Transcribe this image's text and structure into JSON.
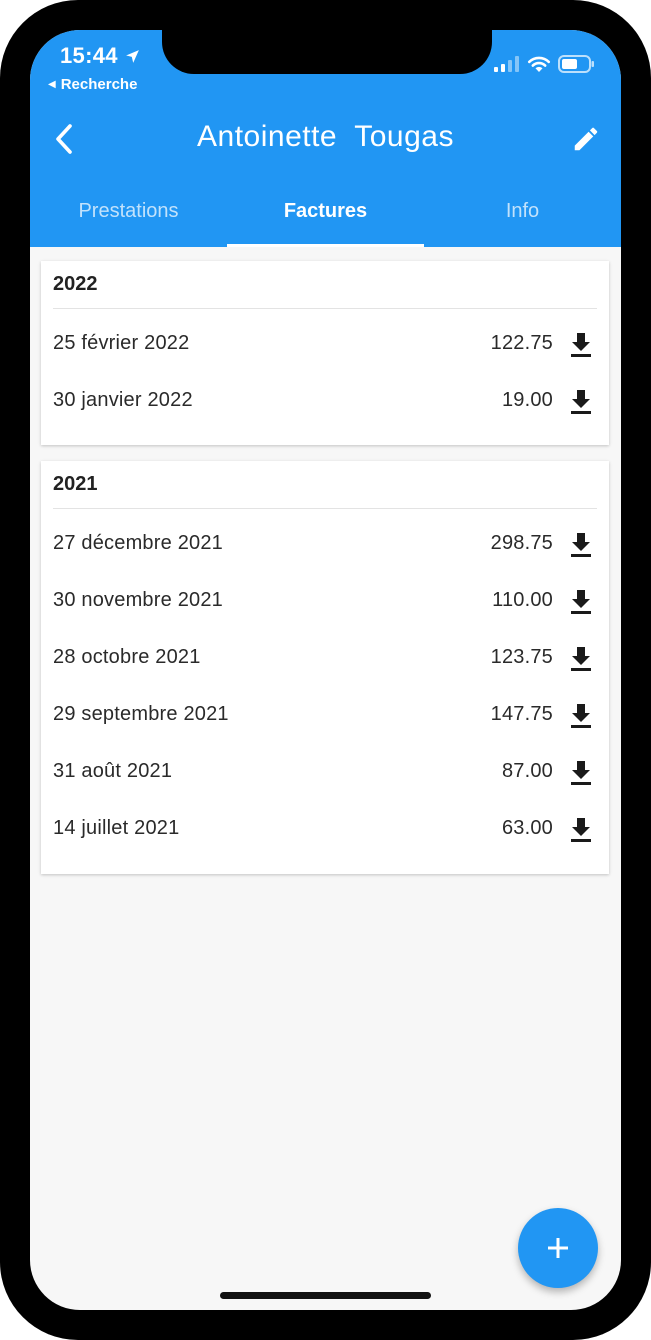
{
  "status": {
    "time": "15:44",
    "back_label": "Recherche"
  },
  "appbar": {
    "title": "Antoinette  Tougas",
    "color": "#2196f3"
  },
  "tabs": [
    {
      "label": "Prestations",
      "active": false
    },
    {
      "label": "Factures",
      "active": true
    },
    {
      "label": "Info",
      "active": false
    }
  ],
  "invoices": [
    {
      "year": "2022",
      "rows": [
        {
          "date": "25 février 2022",
          "amount": "122.75"
        },
        {
          "date": "30 janvier 2022",
          "amount": "19.00"
        }
      ]
    },
    {
      "year": "2021",
      "rows": [
        {
          "date": "27 décembre 2021",
          "amount": "298.75"
        },
        {
          "date": "30 novembre 2021",
          "amount": "110.00"
        },
        {
          "date": "28 octobre 2021",
          "amount": "123.75"
        },
        {
          "date": "29 septembre 2021",
          "amount": "147.75"
        },
        {
          "date": "31 août 2021",
          "amount": "87.00"
        },
        {
          "date": "14 juillet 2021",
          "amount": "63.00"
        }
      ]
    }
  ],
  "icons": {
    "back": "chevron-left-icon",
    "edit": "pencil-icon",
    "download": "download-icon",
    "fab": "plus-icon"
  }
}
